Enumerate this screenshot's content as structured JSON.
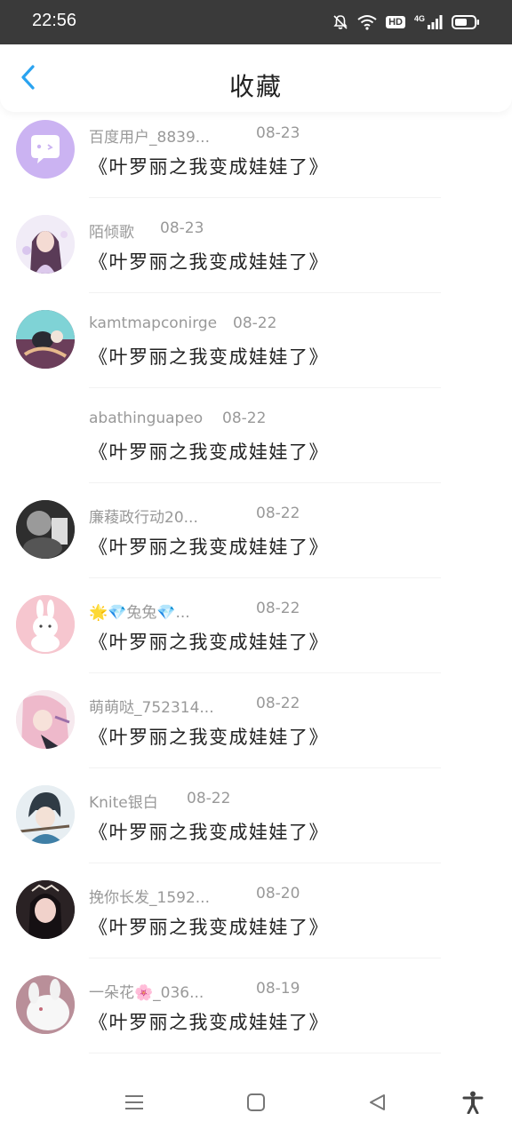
{
  "status_bar": {
    "time": "22:56",
    "hd_label": "HD",
    "network_label": "4G",
    "icons": [
      "mute-icon",
      "wifi-icon",
      "hd-icon",
      "signal-icon",
      "battery-icon"
    ]
  },
  "header": {
    "title": "收藏",
    "back_icon": "chevron-left-icon",
    "accent_color": "#2aa3f0"
  },
  "items": [
    {
      "name": "百度用户_8839...",
      "date": "08-23",
      "title": "《叶罗丽之我变成娃娃了》",
      "avatar": "default-chat-avatar"
    },
    {
      "name": "陌倾歌",
      "date": "08-23",
      "title": "《叶罗丽之我变成娃娃了》",
      "avatar": "anime-girl-purple"
    },
    {
      "name": "kamtmapconirge",
      "date": "08-22",
      "title": "《叶罗丽之我变成娃娃了》",
      "avatar": "anime-figure-teal"
    },
    {
      "name": "abathinguapeo",
      "date": "08-22",
      "title": "《叶罗丽之我变成娃娃了》",
      "avatar": "none"
    },
    {
      "name": "廉薐政行动20...",
      "date": "08-22",
      "title": "《叶罗丽之我变成娃娃了》",
      "avatar": "dark-photo"
    },
    {
      "name": "🌟💎兔兔💎...",
      "date": "08-22",
      "title": "《叶罗丽之我变成娃娃了》",
      "avatar": "pink-bunny"
    },
    {
      "name": "萌萌哒_752314...",
      "date": "08-22",
      "title": "《叶罗丽之我变成娃娃了》",
      "avatar": "anime-pink-hair"
    },
    {
      "name": "Knite银白",
      "date": "08-22",
      "title": "《叶罗丽之我变成娃娃了》",
      "avatar": "anime-boy-blue"
    },
    {
      "name": "挽你长发_1592...",
      "date": "08-20",
      "title": "《叶罗丽之我变成娃娃了》",
      "avatar": "girl-photo"
    },
    {
      "name": "一朵花🌸_036...",
      "date": "08-19",
      "title": "《叶罗丽之我变成娃娃了》",
      "avatar": "white-rabbit"
    }
  ],
  "bottom_nav": {
    "icons": [
      "menu-icon",
      "home-square-icon",
      "back-triangle-icon",
      "accessibility-icon"
    ]
  }
}
